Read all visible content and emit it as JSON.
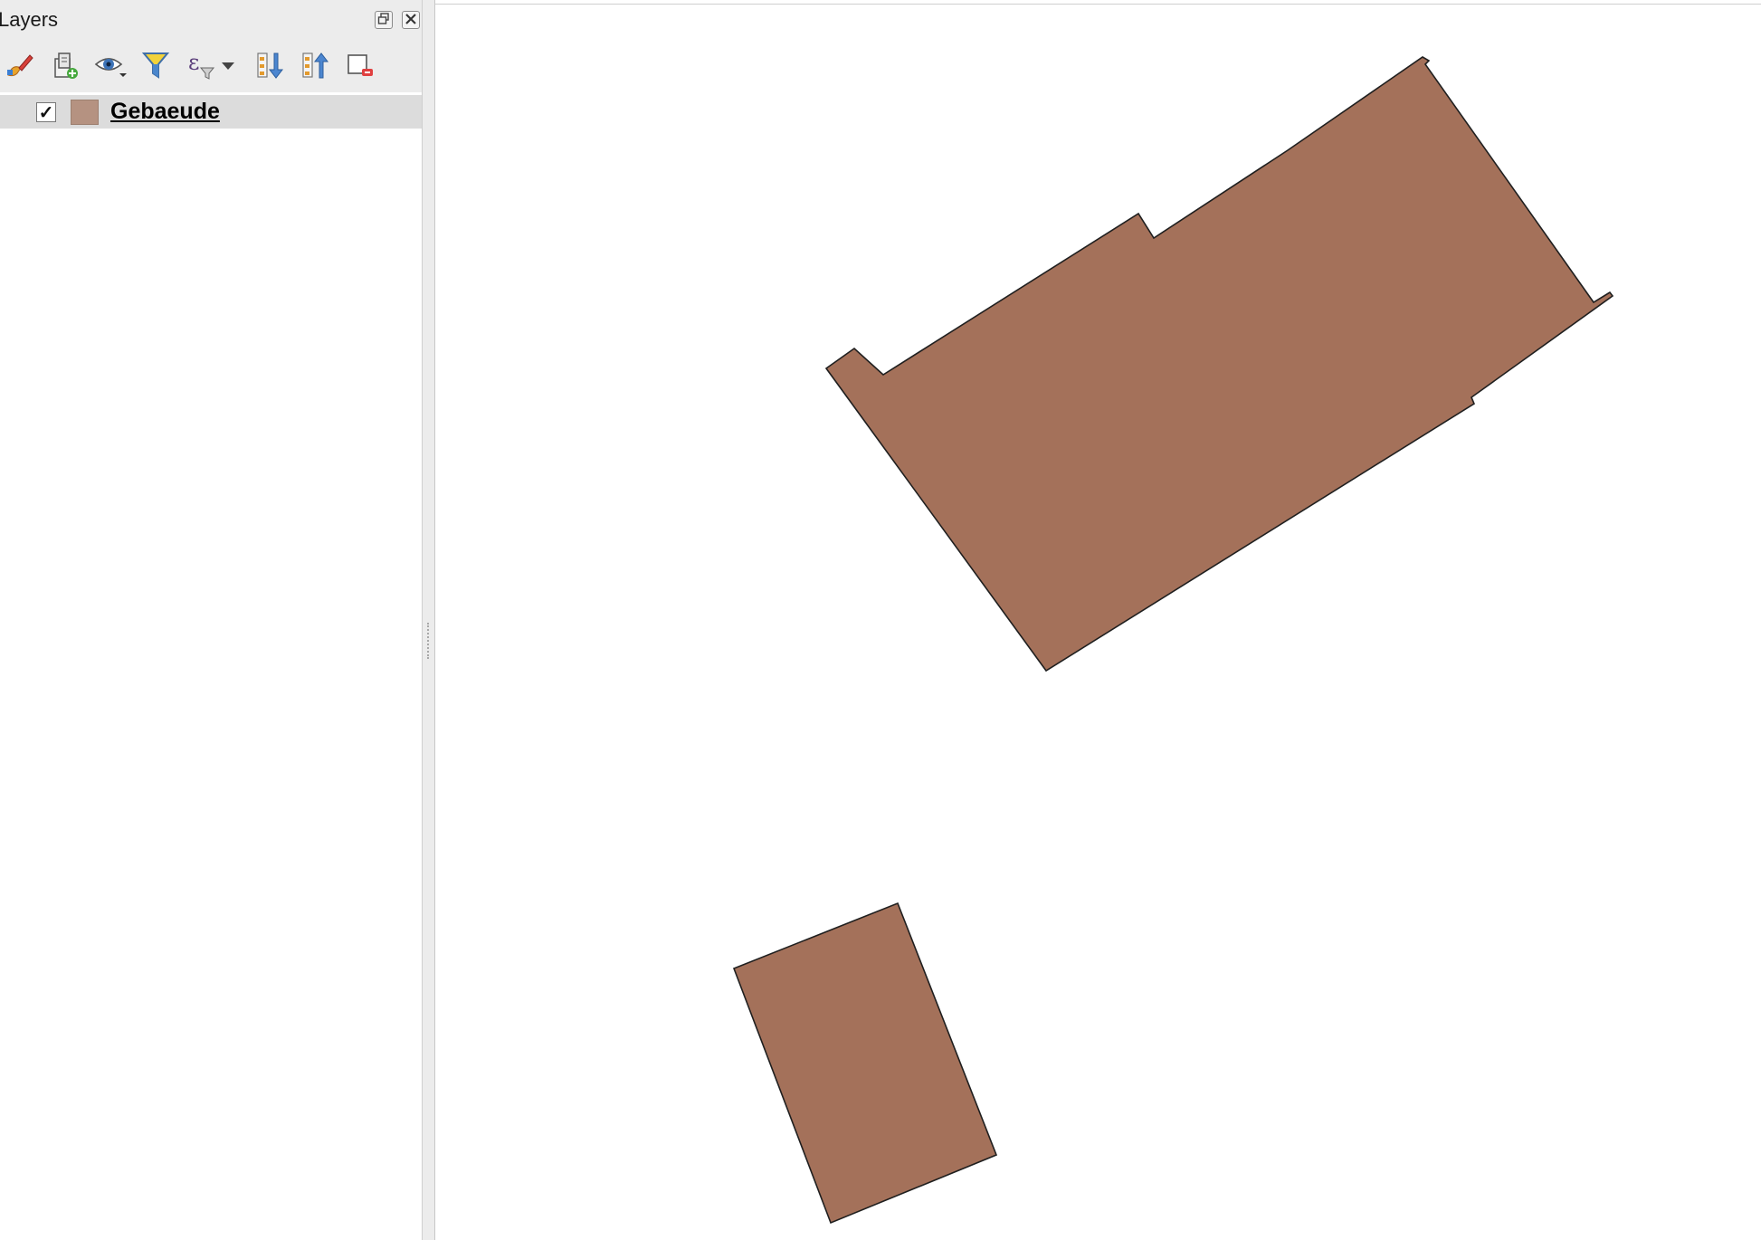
{
  "layers_panel": {
    "title": "Layers",
    "header_buttons": [
      {
        "icon": "float-panel-icon"
      },
      {
        "icon": "close-panel-icon"
      }
    ],
    "toolbar": [
      {
        "icon": "style-paintbrush-icon"
      },
      {
        "icon": "add-group-icon"
      },
      {
        "icon": "visibility-eye-icon"
      },
      {
        "icon": "filter-funnel-icon"
      },
      {
        "icon": "expression-filter-icon"
      },
      {
        "icon": "expand-all-icon"
      },
      {
        "icon": "collapse-all-icon"
      },
      {
        "icon": "remove-layer-icon"
      }
    ],
    "layers": [
      {
        "name": "Gebaeude",
        "checked": true,
        "checkbox_mark": "✓",
        "symbol_color": "#b59281"
      }
    ]
  },
  "map": {
    "background_color": "#ffffff",
    "feature_fill_color": "#a4715a",
    "feature_stroke_color": "#1f1f1f",
    "feature_layer": "Gebaeude",
    "feature_count": 2
  }
}
